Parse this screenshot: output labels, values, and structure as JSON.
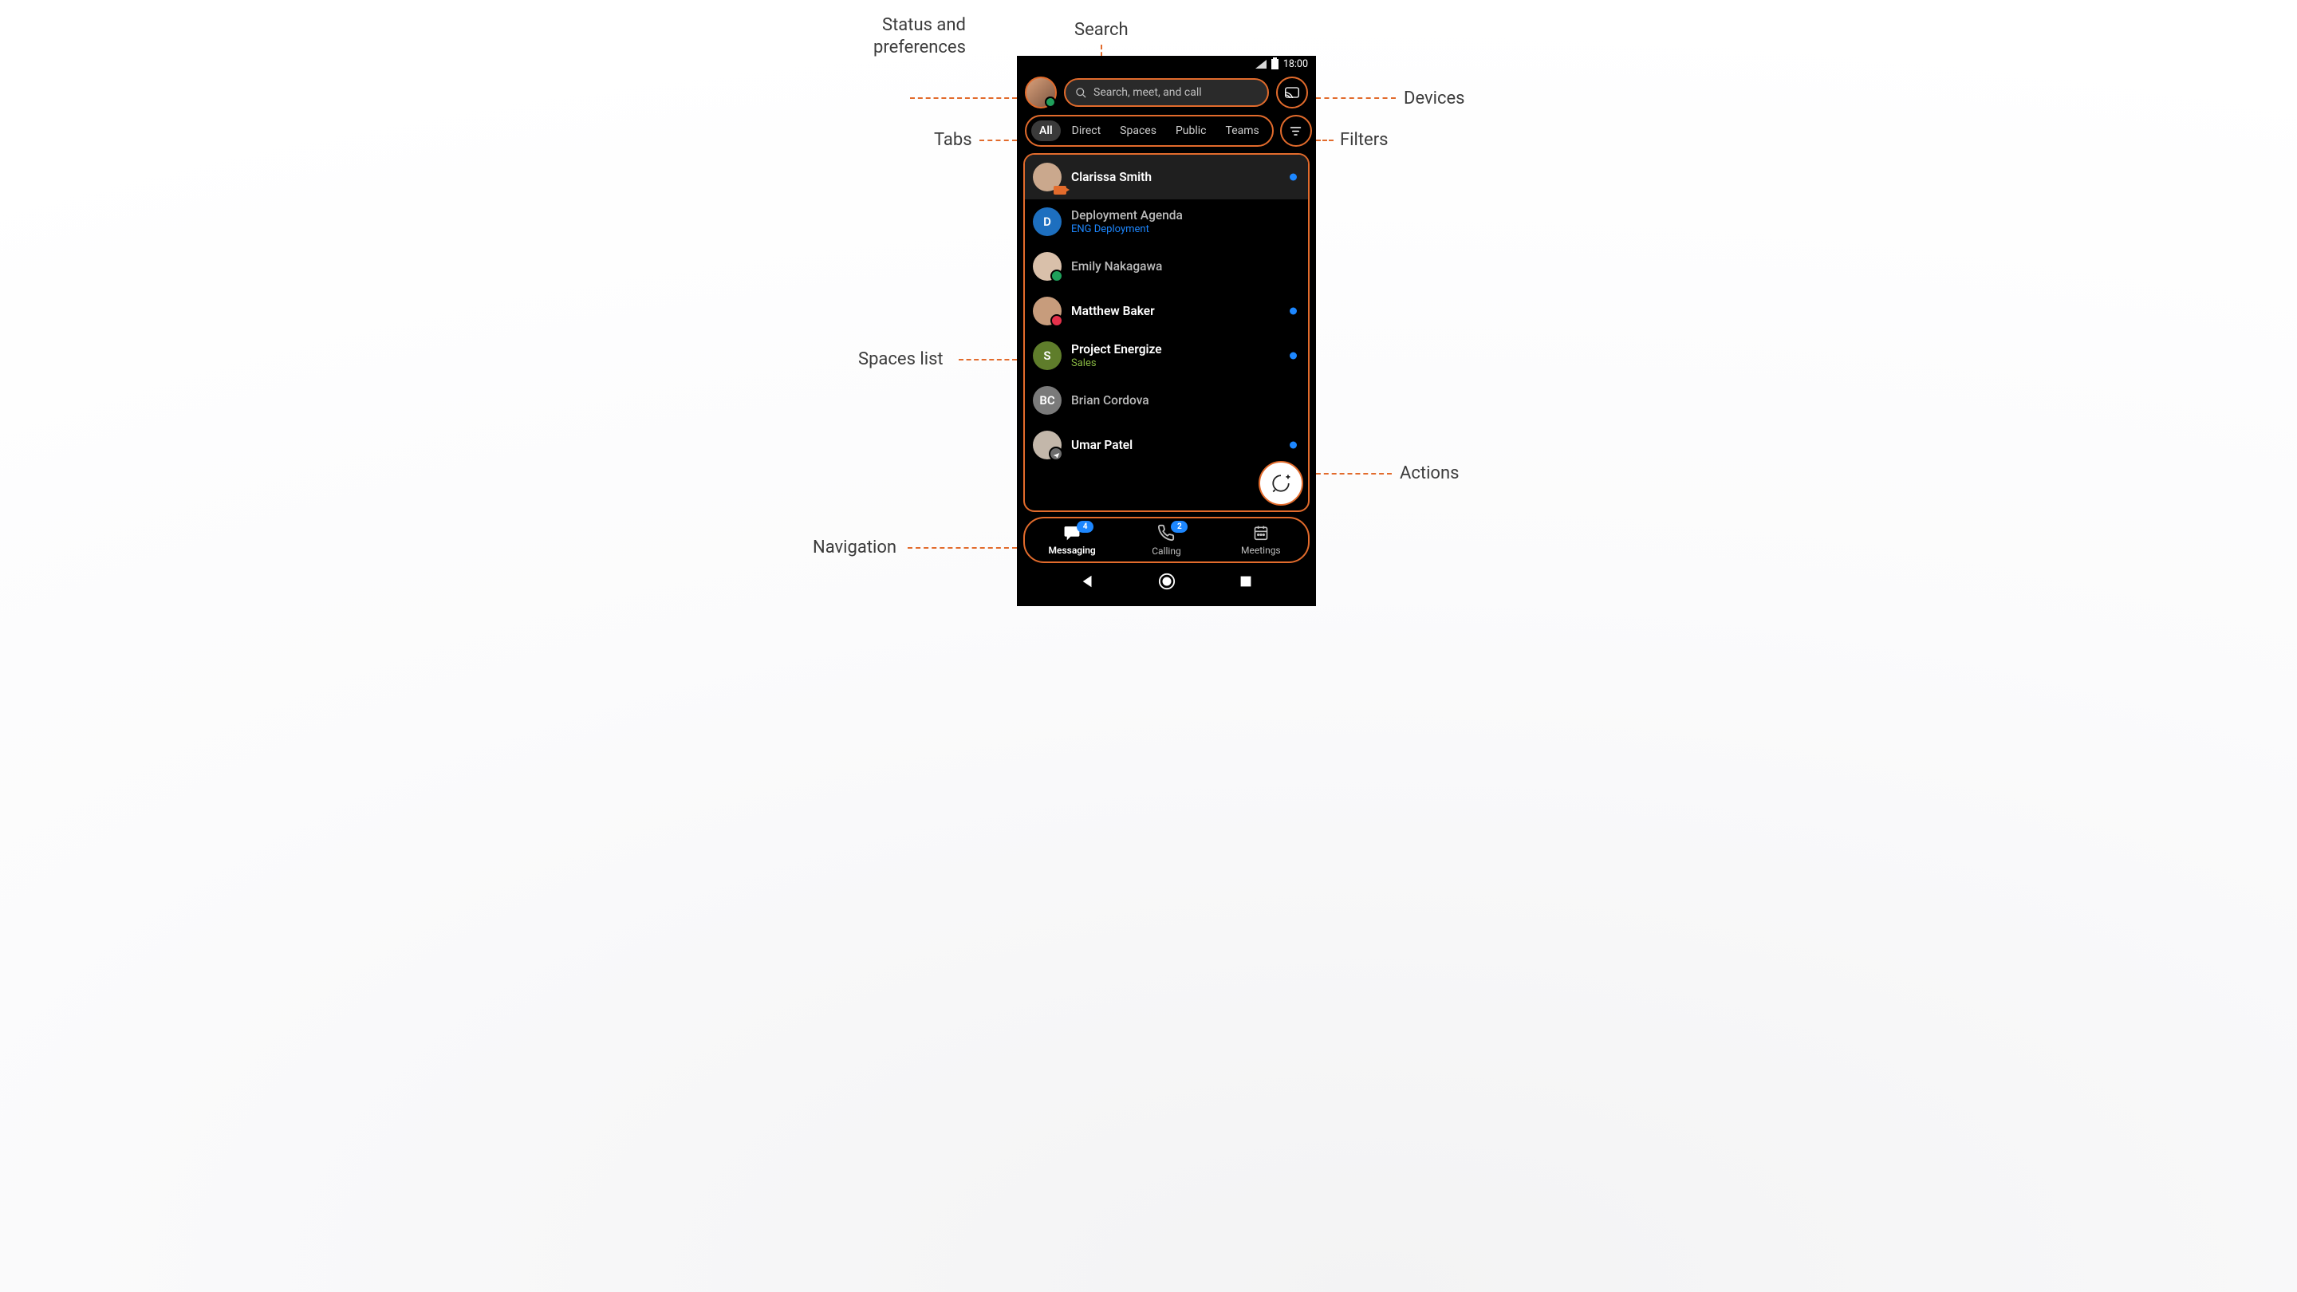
{
  "annotations": {
    "status_prefs": "Status and\npreferences",
    "search": "Search",
    "devices": "Devices",
    "tabs": "Tabs",
    "filters": "Filters",
    "spaces_list": "Spaces list",
    "actions": "Actions",
    "navigation": "Navigation"
  },
  "sysbar": {
    "time": "18:00"
  },
  "search": {
    "placeholder": "Search, meet, and call"
  },
  "tabs": {
    "items": [
      "All",
      "Direct",
      "Spaces",
      "Public",
      "Teams"
    ],
    "selected": "All"
  },
  "spaces": [
    {
      "name": "Clarissa Smith",
      "sub": "",
      "subColor": "",
      "pic": {
        "type": "photo",
        "bg": "#caa88d"
      },
      "badge": "camera",
      "presence": "",
      "unread": true,
      "bold": true,
      "selected": true
    },
    {
      "name": "Deployment Agenda",
      "sub": "ENG Deployment",
      "subColor": "#1d87ff",
      "pic": {
        "type": "letter",
        "text": "D",
        "bg": "#1d6fbf"
      },
      "badge": "",
      "presence": "",
      "unread": false,
      "bold": false
    },
    {
      "name": "Emily Nakagawa",
      "sub": "",
      "subColor": "",
      "pic": {
        "type": "photo",
        "bg": "#d9c0aa"
      },
      "badge": "",
      "presence": "#1fa05b",
      "unread": false,
      "bold": false
    },
    {
      "name": "Matthew Baker",
      "sub": "",
      "subColor": "",
      "pic": {
        "type": "photo",
        "bg": "#c79c7c"
      },
      "badge": "",
      "presence": "#e5314b",
      "unread": true,
      "bold": true
    },
    {
      "name": "Project Energize",
      "sub": "Sales",
      "subColor": "#88b742",
      "pic": {
        "type": "letter",
        "text": "S",
        "bg": "#5f7d2b"
      },
      "badge": "",
      "presence": "",
      "unread": true,
      "bold": true
    },
    {
      "name": "Brian Cordova",
      "sub": "",
      "subColor": "",
      "pic": {
        "type": "letter",
        "text": "BC",
        "bg": "#7a7a7a"
      },
      "badge": "",
      "presence": "",
      "unread": false,
      "bold": false
    },
    {
      "name": "Umar Patel",
      "sub": "",
      "subColor": "",
      "pic": {
        "type": "photo",
        "bg": "#c3b7aa"
      },
      "badge": "plane",
      "presence": "",
      "unread": true,
      "bold": true
    }
  ],
  "nav": {
    "items": [
      {
        "label": "Messaging",
        "icon": "chat",
        "badge": "4",
        "active": true
      },
      {
        "label": "Calling",
        "icon": "phone",
        "badge": "2",
        "active": false
      },
      {
        "label": "Meetings",
        "icon": "calendar",
        "badge": "",
        "active": false
      }
    ]
  },
  "colors": {
    "accent": "#e26b2c",
    "unread": "#1d87ff"
  }
}
